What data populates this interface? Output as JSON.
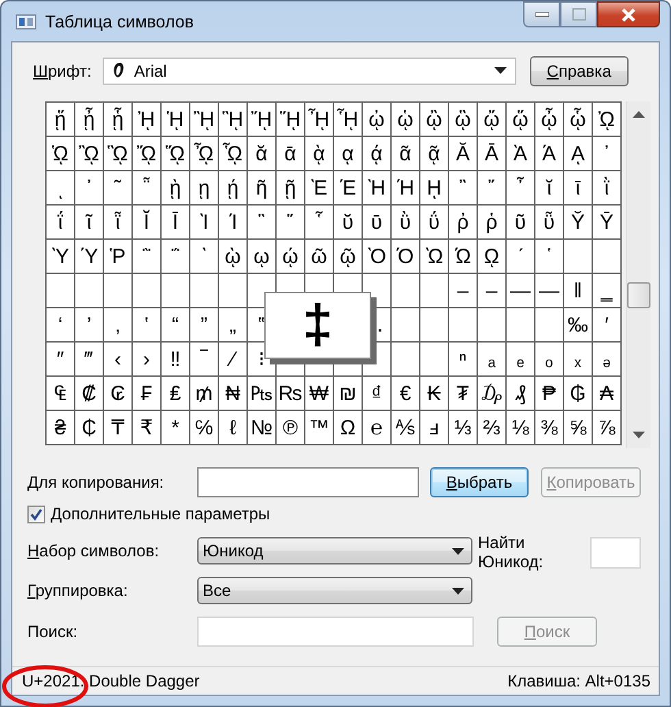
{
  "window": {
    "title": "Таблица символов"
  },
  "font": {
    "label": "Шрифт:",
    "mnemonic": true,
    "value": "Arial"
  },
  "help_button": {
    "label": "Справка",
    "mnemonic": true
  },
  "grid": {
    "rows": [
      [
        "ᾕ",
        "ᾖ",
        "ᾗ",
        "ᾘ",
        "ᾙ",
        "ᾚ",
        "ᾛ",
        "ᾜ",
        "ᾝ",
        "ᾞ",
        "ᾟ",
        "ᾠ",
        "ᾡ",
        "ᾢ",
        "ᾣ",
        "ᾤ",
        "ᾥ",
        "ᾦ",
        "ᾧ",
        "ᾨ"
      ],
      [
        "ᾩ",
        "ᾪ",
        "ᾫ",
        "ᾬ",
        "ᾭ",
        "ᾮ",
        "ᾯ",
        "ᾰ",
        "ᾱ",
        "ᾲ",
        "ᾳ",
        "ᾴ",
        "ᾶ",
        "ᾷ",
        "Ᾰ",
        "Ᾱ",
        "Ὰ",
        "Ά",
        "ᾼ",
        "᾽"
      ],
      [
        "ι",
        "᾿",
        "῀",
        "῁",
        "ῂ",
        "ῃ",
        "ῄ",
        "ῆ",
        "ῇ",
        "Ὲ",
        "Έ",
        "Ὴ",
        "Ή",
        "ῌ",
        "῍",
        "῎",
        "῏",
        "ῐ",
        "ῑ",
        "ῒ"
      ],
      [
        "ΐ",
        "ῖ",
        "ῗ",
        "Ῐ",
        "Ῑ",
        "Ὶ",
        "Ί",
        "῝",
        "῞",
        "῟",
        "ῠ",
        "ῡ",
        "ῢ",
        "ΰ",
        "ῤ",
        "ῥ",
        "ῦ",
        "ῧ",
        "Ῠ",
        "Ῡ"
      ],
      [
        "Ὺ",
        "Ύ",
        "Ῥ",
        "῭",
        "΅",
        "`",
        "ῲ",
        "ῳ",
        "ῴ",
        "ῶ",
        "ῷ",
        "Ὸ",
        "Ό",
        "Ὼ",
        "Ώ",
        "ῼ",
        "´",
        "῾",
        null,
        null
      ],
      [
        null,
        null,
        null,
        null,
        null,
        null,
        null,
        null,
        null,
        null,
        null,
        null,
        null,
        null,
        "‒",
        "–",
        "—",
        "―",
        "‖",
        "‗"
      ],
      [
        "‘",
        "’",
        "‚",
        "‛",
        "“",
        "”",
        "„",
        "‟",
        null,
        null,
        null,
        "‥",
        null,
        null,
        null,
        null,
        null,
        null,
        "‰",
        "′"
      ],
      [
        "″",
        "‴",
        "‹",
        "›",
        "‼",
        "‾",
        "⁄",
        "⁝",
        null,
        null,
        null,
        null,
        null,
        null,
        "ⁿ",
        "ₐ",
        "ₑ",
        "ₒ",
        "ₓ",
        "ₔ"
      ],
      [
        "₠",
        "₡",
        "₢",
        "₣",
        "₤",
        "₥",
        "₦",
        "₧",
        "₨",
        "₩",
        "₪",
        "₫",
        "€",
        "₭",
        "₮",
        "₯",
        "₰",
        "₱",
        "₲",
        "₳"
      ],
      [
        "₴",
        "₵",
        "₸",
        "₹",
        "*",
        "℅",
        "ℓ",
        "№",
        "℗",
        "™",
        "Ω",
        "℮",
        "⅍",
        "ⅎ",
        "⅓",
        "⅔",
        "⅛",
        "⅜",
        "⅝",
        "⅞"
      ]
    ],
    "magnified": "‡"
  },
  "copy": {
    "label": "Для копирования:",
    "select_button": {
      "label": "Выбрать",
      "mnemonic": true,
      "default": true
    },
    "copy_button": {
      "label": "Копировать",
      "mnemonic": true,
      "disabled": true
    }
  },
  "advanced": {
    "label": "Дополнительные параметры",
    "mnemonic": true,
    "checked": true
  },
  "charset": {
    "label": "Набор символов:",
    "mnemonic": true,
    "value": "Юникод"
  },
  "find_unicode": {
    "label": "Найти Юникод:"
  },
  "grouping": {
    "label": "Группировка:",
    "mnemonic": true,
    "value": "Все"
  },
  "search": {
    "label": "Поиск:",
    "button": {
      "label": "Поиск",
      "mnemonic": true,
      "disabled": true
    }
  },
  "status_bar": {
    "description": "U+2021: Double Dagger",
    "keystroke": "Клавиша: Alt+0135",
    "circled": true
  }
}
